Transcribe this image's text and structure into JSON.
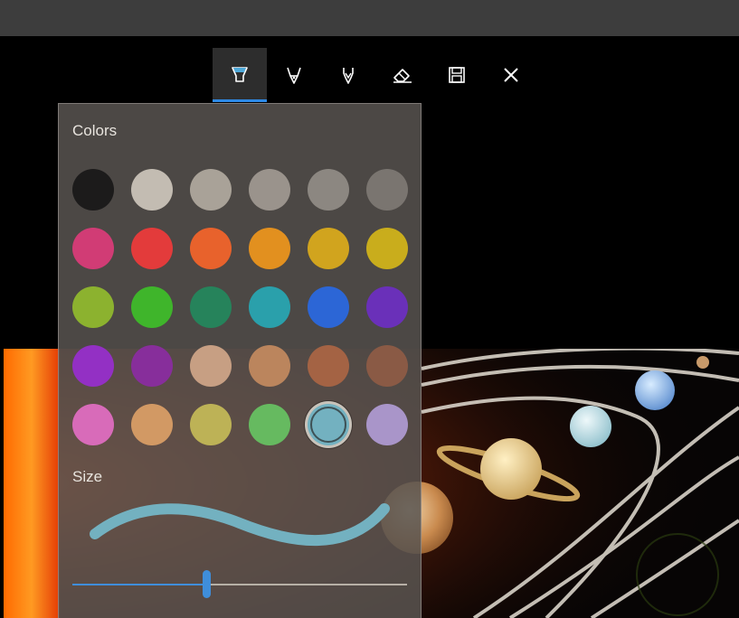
{
  "toolbar": {
    "tools": [
      {
        "name": "highlighter",
        "icon": "highlighter-icon",
        "active": true
      },
      {
        "name": "ballpoint-pen",
        "icon": "ballpoint-pen-icon",
        "active": false
      },
      {
        "name": "calligraphy-pen",
        "icon": "calligraphy-pen-icon",
        "active": false
      },
      {
        "name": "eraser",
        "icon": "eraser-icon",
        "active": false
      },
      {
        "name": "save",
        "icon": "save-icon",
        "active": false
      },
      {
        "name": "close",
        "icon": "close-icon",
        "active": false
      }
    ],
    "accent": "#2e8ae6"
  },
  "panel": {
    "colors_heading": "Colors",
    "size_heading": "Size",
    "colors": [
      [
        "#1c1b1b",
        "#c3bcb2",
        "#a9a298",
        "#9a938c",
        "#8c8781",
        "#7a7570"
      ],
      [
        "#d13c75",
        "#e33b3b",
        "#e8622c",
        "#e2901f",
        "#d1a41e",
        "#c9ad1c"
      ],
      [
        "#8cb22f",
        "#3fb52b",
        "#26835b",
        "#2aa0ab",
        "#2c66d6",
        "#6a30b9"
      ],
      [
        "#9330c4",
        "#872e9b",
        "#c79f83",
        "#bb855d",
        "#a46344",
        "#8a5a45"
      ],
      [
        "#d86bb9",
        "#d29964",
        "#bdb256",
        "#66ba60",
        "#73b1c0",
        "#a995c9"
      ]
    ],
    "selected_color": {
      "row": 4,
      "col": 4,
      "hex": "#73b1c0"
    },
    "size_value": 0.4
  }
}
